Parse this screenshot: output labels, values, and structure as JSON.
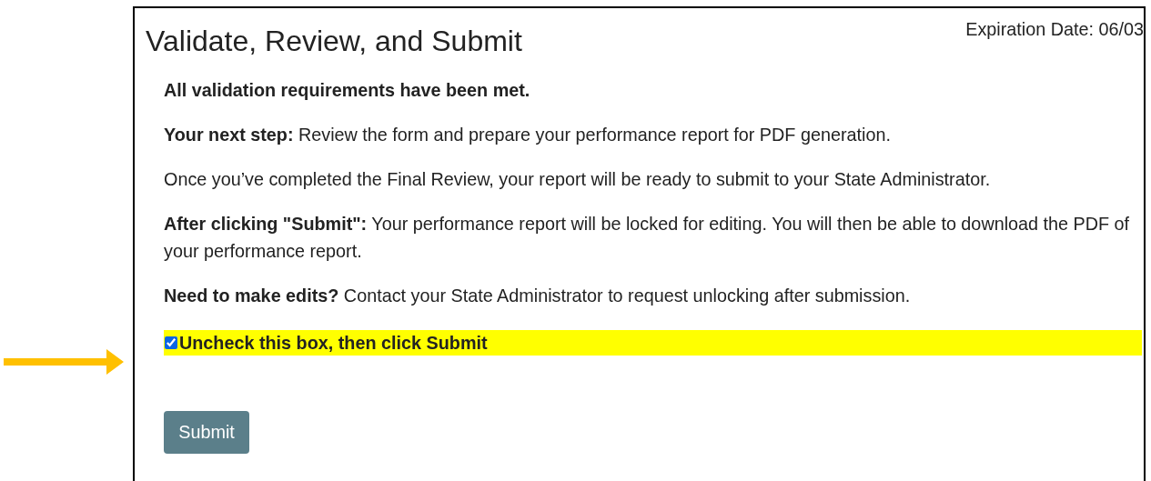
{
  "panel": {
    "title": "Validate, Review, and Submit",
    "expiration": "Expiration Date: 06/03",
    "paragraphs": [
      "**All validation requirements have been met.**",
      "**Your next step:** Review the form and prepare your performance report for PDF generation.",
      "Once you’ve completed the Final Review, your report will be ready to submit to your State Administrator.",
      "**After clicking \"Submit\":** Your performance report will be locked for editing. You will then be able to download the PDF of your performance report.",
      "**Need to make edits?** Contact your State Administrator to request unlocking after submission."
    ],
    "confirm": {
      "label": "Uncheck this box, then click Submit",
      "checked": true
    },
    "button": "Submit"
  }
}
